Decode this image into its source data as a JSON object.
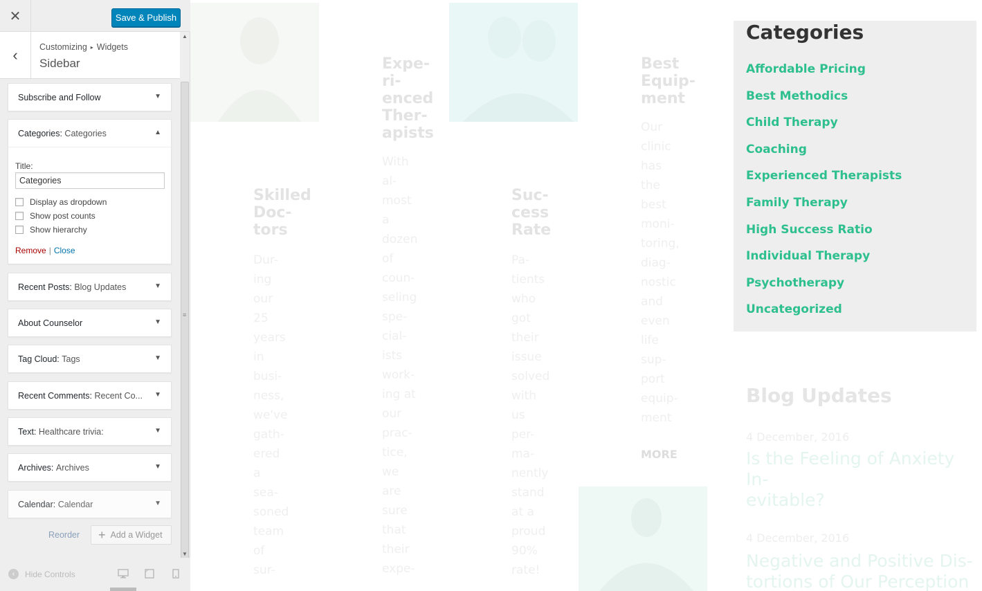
{
  "customizer": {
    "close_icon": "close-icon",
    "publish_label": "Save & Publish",
    "breadcrumb": {
      "root": "Customizing",
      "section": "Widgets"
    },
    "panel_title": "Sidebar",
    "widgets": [
      {
        "title": "Subscribe and Follow",
        "subtitle": ""
      },
      {
        "title": "Categories:",
        "subtitle": "Categories"
      },
      {
        "title": "Recent Posts:",
        "subtitle": "Blog Updates"
      },
      {
        "title": "About Counselor",
        "subtitle": ""
      },
      {
        "title": "Tag Cloud:",
        "subtitle": "Tags"
      },
      {
        "title": "Recent Comments:",
        "subtitle": "Recent Co..."
      },
      {
        "title": "Text:",
        "subtitle": "Healthcare trivia:"
      },
      {
        "title": "Archives:",
        "subtitle": "Archives"
      },
      {
        "title": "Calendar:",
        "subtitle": "Calendar"
      }
    ],
    "categories_form": {
      "title_label": "Title:",
      "title_value": "Categories",
      "options": [
        "Display as dropdown",
        "Show post counts",
        "Show hierarchy"
      ],
      "remove_label": "Remove",
      "separator": "|",
      "close_label": "Close"
    },
    "reorder_label": "Reorder",
    "add_widget_label": "Add a Widget",
    "hide_controls_label": "Hide Controls"
  },
  "preview": {
    "features": [
      {
        "title_lines": [
          "Skilled",
          "Doc-",
          "tors"
        ],
        "text_lines": [
          "Dur-",
          "ing",
          "our",
          "25",
          "years",
          "in",
          "busi-",
          "ness,",
          "we've",
          "gath-",
          "ered",
          "a",
          "sea-",
          "soned",
          "team",
          "of",
          "sur-"
        ]
      },
      {
        "title_lines": [
          "Expe-",
          "ri-",
          "enced",
          "Ther-",
          "apists"
        ],
        "text_lines": [
          "With",
          "al-",
          "most",
          "a",
          "dozen",
          "of",
          "coun-",
          "seling",
          "spe-",
          "cial-",
          "ists",
          "work-",
          "ing at",
          "our",
          "prac-",
          "tice,",
          "we",
          "are",
          "sure",
          "that",
          "their",
          "expe-"
        ]
      },
      {
        "title_lines": [
          "Suc-",
          "cess",
          "Rate"
        ],
        "text_lines": [
          "Pa-",
          "tients",
          "who",
          "got",
          "their",
          "issue",
          "solved",
          "with",
          "us",
          "per-",
          "ma-",
          "nently",
          "stand",
          "at a",
          "proud",
          "90%",
          "rate!"
        ]
      },
      {
        "title_lines": [
          "Best",
          "Equip-",
          "ment"
        ],
        "text_lines": [
          "Our",
          "clinic",
          "has",
          "the",
          "best",
          "moni-",
          "toring,",
          "diag-",
          "nostic",
          "and",
          "even",
          "life",
          "sup-",
          "port",
          "equip-",
          "ment"
        ],
        "more": "MORE"
      }
    ],
    "categories_widget": {
      "title": "Categories",
      "link_color": "#2dbf8e",
      "items": [
        "Affordable Pricing",
        "Best Methodics",
        "Child Therapy",
        "Coaching",
        "Experienced Therapists",
        "Family Therapy",
        "High Success Ratio",
        "Individual Therapy",
        "Psychotherapy",
        "Uncategorized"
      ]
    },
    "blog": {
      "title": "Blog Updates",
      "posts": [
        {
          "date": "4 December, 2016",
          "title_lines": [
            "Is the Feeling of Anxiety In-",
            "evitable?"
          ]
        },
        {
          "date": "4 December, 2016",
          "title_lines": [
            "Negative and Positive Dis-",
            "tortions of Our Perception of"
          ]
        }
      ]
    }
  }
}
